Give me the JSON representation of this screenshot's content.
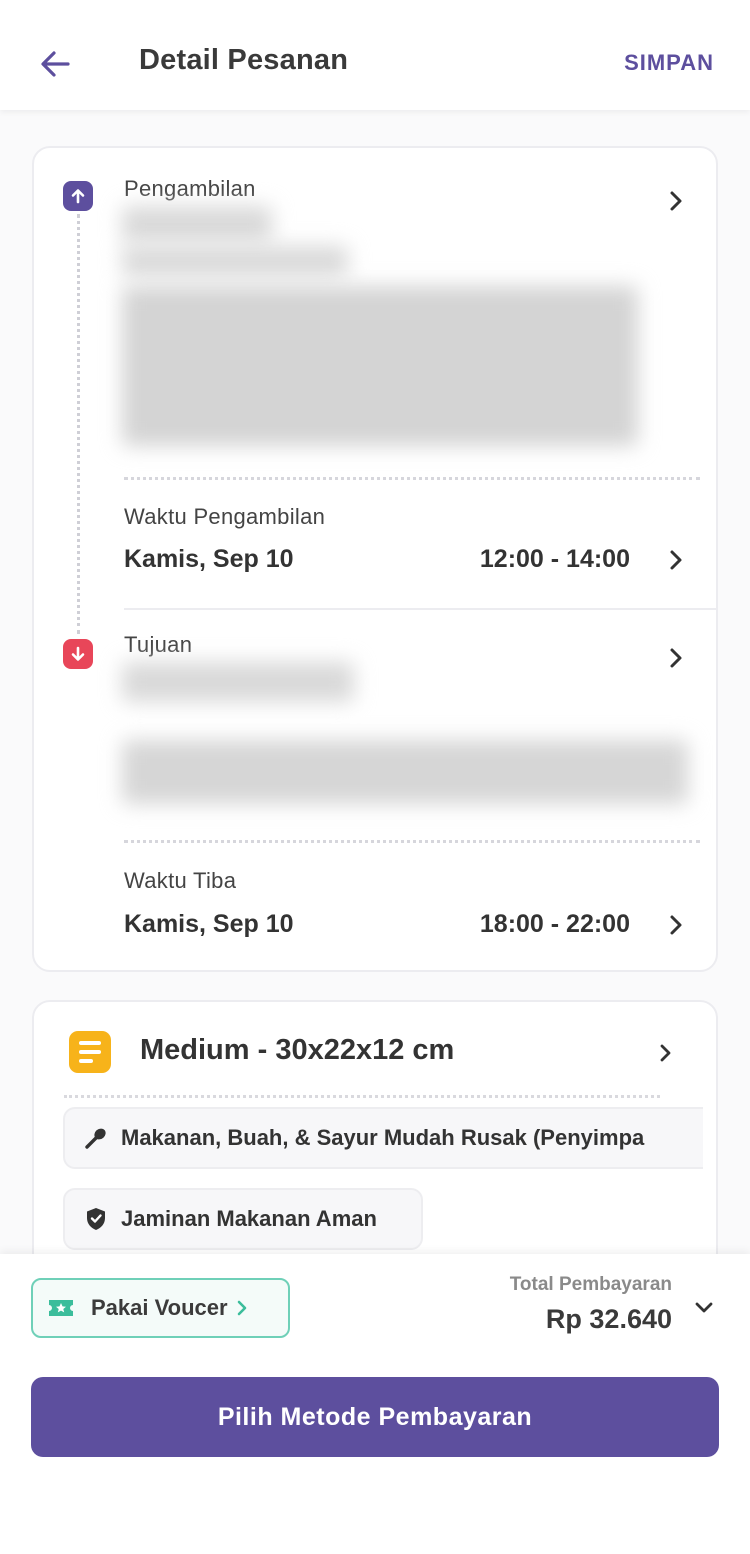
{
  "header": {
    "title": "Detail Pesanan",
    "save_label": "SIMPAN",
    "back_icon": "arrow-left-icon"
  },
  "route": {
    "pickup": {
      "label": "Pengambilan",
      "time_label": "Waktu Pengambilan",
      "date": "Kamis, Sep 10",
      "time": "12:00 - 14:00"
    },
    "destination": {
      "label": "Tujuan",
      "time_label": "Waktu Tiba",
      "date": "Kamis, Sep 10",
      "time": "18:00 - 22:00"
    }
  },
  "package": {
    "title": "Medium - 30x22x12 cm",
    "chips": [
      {
        "label": "Makanan, Buah, & Sayur Mudah Rusak (Penyimpa",
        "icon": "food-icon"
      },
      {
        "label": "Jaminan Makanan Aman",
        "icon": "shield-check-icon"
      }
    ]
  },
  "footer": {
    "voucher_label": "Pakai Voucer",
    "total_label": "Total Pembayaran",
    "total_value": "Rp 32.640",
    "pay_button": "Pilih Metode Pembayaran"
  },
  "colors": {
    "primary": "#5d4f9e",
    "pickup_icon": "#5d4f9e",
    "destination_icon": "#e84659",
    "package_icon": "#f7b31a",
    "voucher_border": "#6fd0b8"
  }
}
